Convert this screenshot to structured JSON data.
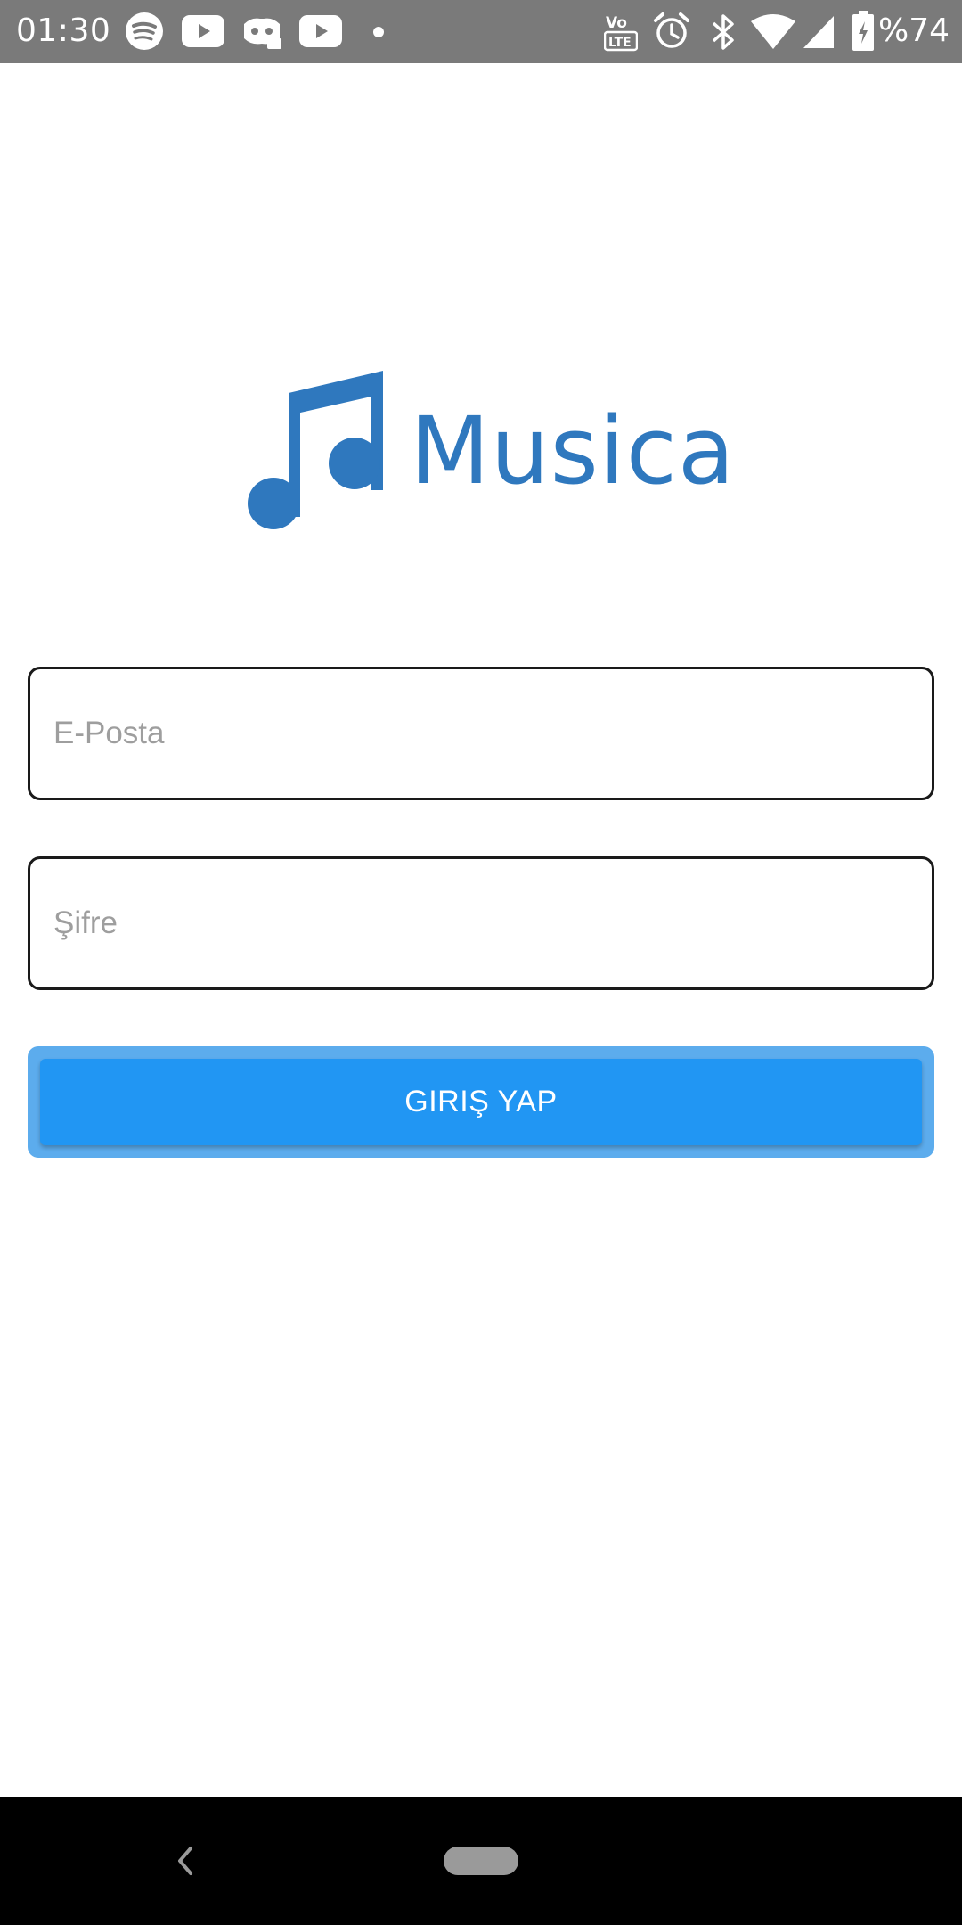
{
  "status_bar": {
    "time": "01:30",
    "battery_percent": "%74",
    "notification_icons": [
      "spotify-icon",
      "youtube-icon",
      "discord-icon",
      "youtube-icon",
      "dot-icon"
    ],
    "system_icons": [
      "volte-icon",
      "alarm-icon",
      "bluetooth-icon",
      "wifi-icon",
      "signal-icon",
      "battery-icon"
    ]
  },
  "logo": {
    "text": "Musica",
    "icon": "music-note-icon",
    "color": "#2f78be"
  },
  "form": {
    "email_placeholder": "E-Posta",
    "email_value": "",
    "password_placeholder": "Şifre",
    "password_value": "",
    "login_label": "GIRIŞ YAP"
  },
  "colors": {
    "accent": "#2196f3",
    "status_bar": "#7a7a7a",
    "nav_bar": "#000000"
  },
  "nav_bar": {
    "back_icon": "back-chevron-icon",
    "home_icon": "home-pill-icon"
  }
}
